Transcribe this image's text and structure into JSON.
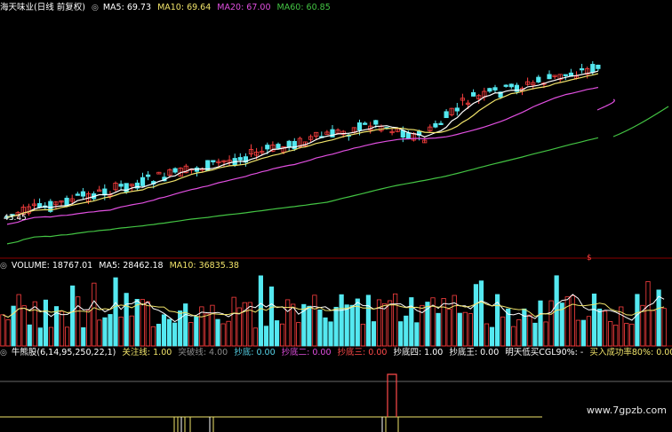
{
  "price_panel": {
    "title": "海天味业(日线 前复权)",
    "indicators": [
      {
        "label": "MA5: 69.73",
        "color": "#ffffff"
      },
      {
        "label": "MA10: 69.64",
        "color": "#f0e36a"
      },
      {
        "label": "MA20: 67.00",
        "color": "#e14fe0"
      },
      {
        "label": "MA60: 60.85",
        "color": "#43c443"
      }
    ],
    "low_label": "43.45",
    "marker": "$"
  },
  "volume_panel": {
    "indicators": [
      {
        "label": "VOLUME: 18767.01",
        "color": "#ffffff"
      },
      {
        "label": "MA5: 28462.18",
        "color": "#ffffff"
      },
      {
        "label": "MA10: 36835.38",
        "color": "#f0e36a"
      }
    ]
  },
  "signal_panel": {
    "indicators": [
      {
        "label": "牛熊股(6,14,95,250,22,1)",
        "color": "#ffffff"
      },
      {
        "label": "关注线: 1.00",
        "color": "#f0e36a"
      },
      {
        "label": "突破线: 4.00",
        "color": "#8a8a8a"
      },
      {
        "label": "抄底: 0.00",
        "color": "#56d3e8"
      },
      {
        "label": "抄底二: 0.00",
        "color": "#e14fe0"
      },
      {
        "label": "抄底三: 0.00",
        "color": "#ff4a4a"
      },
      {
        "label": "抄底四: 1.00",
        "color": "#ffffff"
      },
      {
        "label": "抄底王: 0.00",
        "color": "#ffffff"
      },
      {
        "label": "明天低买CGL90%: -",
        "color": "#ffffff"
      },
      {
        "label": "买入成功率80%: 0.00",
        "color": "#f0e36a"
      }
    ]
  },
  "watermark": "www.7gpzb.com",
  "colors": {
    "up": "#ff4040",
    "down": "#54e8f0",
    "background": "#000000",
    "panel_border": "#8b0000"
  }
}
